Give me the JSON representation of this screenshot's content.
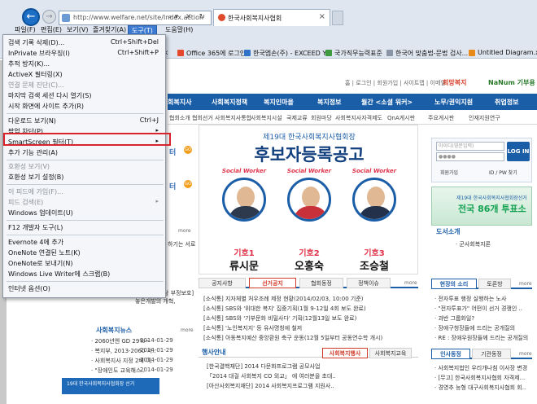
{
  "browser": {
    "address": "http://www.welfare.net/site/Index.action",
    "tab_title": "한국사회복지사협회",
    "menu": [
      {
        "label": "파일(F)",
        "active": false
      },
      {
        "label": "편집(E)",
        "active": false
      },
      {
        "label": "보기(V)",
        "active": false
      },
      {
        "label": "즐겨찾기(A)",
        "active": false
      },
      {
        "label": "도구(T)",
        "active": true
      },
      {
        "label": "도움말(H)",
        "active": false
      }
    ],
    "favorites": [
      "Office 365에 로그인",
      "한국엡손(주) - EXCEED Y...",
      "국가직무능력표준",
      "한국어 맞춤법-문법 검사...",
      "Untitled Diagram.xml -"
    ],
    "fav_prefix": "ook"
  },
  "tools_menu": {
    "items": [
      {
        "label": "검색 기록 삭제(D)...",
        "shortcut": "Ctrl+Shift+Del",
        "disabled": false
      },
      {
        "label": "InPrivate 브라우징(I)",
        "shortcut": "Ctrl+Shift+P",
        "disabled": false
      },
      {
        "label": "추적 방지(K)...",
        "shortcut": "",
        "disabled": false
      },
      {
        "label": "ActiveX 필터링(X)",
        "shortcut": "",
        "disabled": false
      },
      {
        "label": "연결 문제 진단(C)...",
        "shortcut": "",
        "disabled": true
      },
      {
        "label": "마지막 검색 세션 다시 열기(S)",
        "shortcut": "",
        "disabled": false
      },
      {
        "label": "시작 화면에 사이트 추가(R)",
        "shortcut": "",
        "disabled": false
      },
      {
        "label": "다운로드 보기(N)",
        "shortcut": "Ctrl+J",
        "disabled": false
      },
      {
        "label": "팝업 차단(P)",
        "shortcut": "",
        "disabled": false,
        "submenu": true
      },
      {
        "label": "SmartScreen 필터(T)",
        "shortcut": "",
        "disabled": false,
        "submenu": true
      },
      {
        "label": "추가 기능 관리(A)",
        "shortcut": "",
        "disabled": false
      },
      {
        "label": "호환성 보기(V)",
        "shortcut": "",
        "disabled": true
      },
      {
        "label": "호환성 보기 설정(B)",
        "shortcut": "",
        "disabled": false,
        "highlighted": true
      },
      {
        "label": "이 피드에 가입(F)...",
        "shortcut": "",
        "disabled": true
      },
      {
        "label": "피드 검색(E)",
        "shortcut": "",
        "disabled": true,
        "submenu": true
      },
      {
        "label": "Windows 업데이트(U)",
        "shortcut": "",
        "disabled": false
      },
      {
        "label": "F12 개발자 도구(L)",
        "shortcut": "",
        "disabled": false
      },
      {
        "label": "Evernote 4에 추가",
        "shortcut": "",
        "disabled": false
      },
      {
        "label": "OneNote 연결된 노트(K)",
        "shortcut": "",
        "disabled": false
      },
      {
        "label": "OneNote로 보내기(N)",
        "shortcut": "",
        "disabled": false
      },
      {
        "label": "Windows Live Writer에 스크랩(B)",
        "shortcut": "",
        "disabled": false
      },
      {
        "label": "인터넷 옵션(O)",
        "shortcut": "",
        "disabled": false
      }
    ]
  },
  "site": {
    "toplinks": "홈  |  로그인  |  회원가입  |  사이트맵  |  이메일",
    "brand1": "희망복지",
    "brand2": "NaNum 기부용",
    "gnb": [
      "회복지사",
      "사회복지정책",
      "복지인마을",
      "복지정보",
      "월간 <소셜 워커>",
      "노무/권익지원",
      "취업정보"
    ],
    "subnav": [
      "협회소개",
      "협회선거",
      "사회복지사통합",
      "사회복지시설",
      "국제교류",
      "회원마당",
      "사회복지사자격제도",
      "QnA게시판",
      "주요게시판",
      "인재지원연구"
    ],
    "banner": {
      "title": "제19대 한국사회복지사협회장",
      "main": "후보자등록공고",
      "sw": "Social Worker",
      "candidates": [
        {
          "no": "기호1",
          "name": "류시문"
        },
        {
          "no": "기호2",
          "name": "오홍숙"
        },
        {
          "no": "기호3",
          "name": "조승철"
        }
      ]
    },
    "left": {
      "title1": "터",
      "title2": "터",
      "more": "more",
      "snippet1": "하기는 서로",
      "snippet2": "[사회복지사상 부정보호]",
      "snippet3": "놓은개발의 개혁,",
      "news_heading": "사회복지뉴스",
      "news": [
        {
          "text": "· 2060년엔 GD 29%~",
          "date": "2014-01-29"
        },
        {
          "text": "· 복지부, 2013-2060 서..",
          "date": "2014-01-29"
        },
        {
          "text": "· 사회복지사 지정 2배 이..",
          "date": "2014-01-29"
        },
        {
          "text": "· \"장애인도 교육해스..",
          "date": "2014-01-29"
        }
      ],
      "bottom_banner": "19대 한국사회복지사협회장 선거"
    },
    "newstabs": [
      "공지사항",
      "선거공지",
      "협회동정",
      "정책이슈"
    ],
    "news_more": "more",
    "news": [
      "[소식통] 지자체별 처우조례 제정 현황(2014/02/03, 10:00 기준)",
      "[소식통] SBS와 '위대한 복지' 집중기획(1월 9-12일 4회 보도 완료)",
      "[소식통] SBS와 '기부문화 비밀사다' 기획(12월13일 보도 완료)",
      "[소식통] '노인복지지' 등 유사명칭에 철저",
      "[소식통] 아동복지예산 중앙환원 축구 운동(12월 5일부터 공동연수학 개시)"
    ],
    "event_heading": "행사안내",
    "event_tabs": [
      "사회복지행사",
      "사회복지교육"
    ],
    "events": [
      "[한국결핵재단] 2014 다문화프로그램 공모사업",
      "「2014 대걸 사회복지 CO 외교」 에 여러분을 초대..",
      "[아산사회복지재단] 2014 사회복지프로그램 지원사.."
    ],
    "login": {
      "id_placeholder": "아이디(영문입력)",
      "pw_placeholder": "●●●●",
      "button": "LOG IN",
      "join": "회원가입",
      "find": "ID / PW 찾기"
    },
    "right_banner": {
      "t1": "제19대 한국사회복지사협회장선거",
      "t2": "전국 86개 투표소"
    },
    "dosuk": "도서소개",
    "dosuk_item": "· 군사회복지론",
    "voice_tabs": [
      "현장의 소리",
      "토론방"
    ],
    "voice": [
      "· 전자투표 행정 실행하는 노사",
      "· \"전자투표가\" 어떤이 선거 경쟁인 ..",
      "· 과반 그룹화일?",
      "· 장애구청장들에 드리는 공개질의",
      "· RE : 장애우원장들께 드리는 공개질의"
    ],
    "job_tabs": [
      "인사동정",
      "기관동정"
    ],
    "jobs": [
      "· 사회복지법인 우리개나침 이사장 변경",
      "· [무고] 한국사회복지사협회 자격제...",
      "· 경영추 능형 대구사회복지사협회 회.."
    ]
  }
}
